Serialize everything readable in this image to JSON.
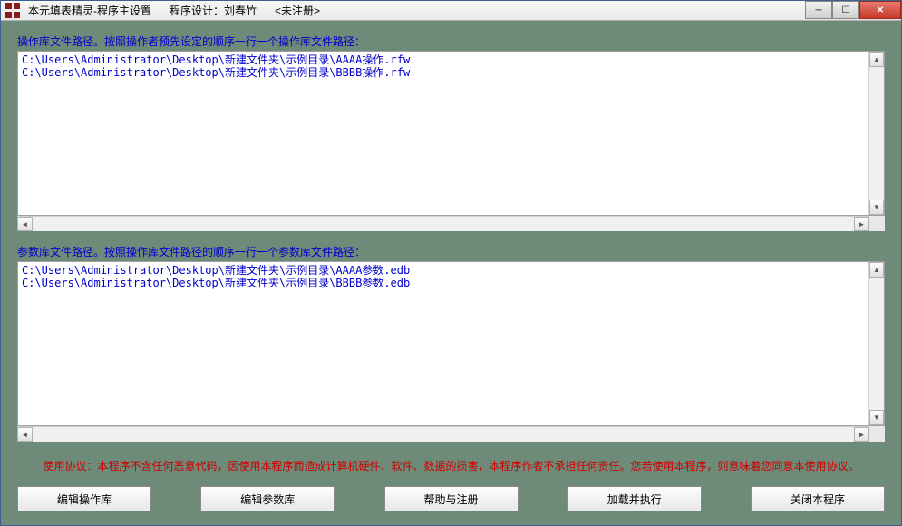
{
  "titlebar": {
    "title": "本元填表精灵-程序主设置",
    "designer": "程序设计：刘春竹",
    "registration": "<未注册>"
  },
  "section1": {
    "label": "操作库文件路径。按照操作者预先设定的顺序一行一个操作库文件路径：",
    "content": "C:\\Users\\Administrator\\Desktop\\新建文件夹\\示例目录\\AAAA操作.rfw\nC:\\Users\\Administrator\\Desktop\\新建文件夹\\示例目录\\BBBB操作.rfw"
  },
  "section2": {
    "label": "参数库文件路径。按照操作库文件路径的顺序一行一个参数库文件路径：",
    "content": "C:\\Users\\Administrator\\Desktop\\新建文件夹\\示例目录\\AAAA参数.edb\nC:\\Users\\Administrator\\Desktop\\新建文件夹\\示例目录\\BBBB参数.edb"
  },
  "agreement": "使用协议：本程序不含任何恶意代码，因使用本程序而造成计算机硬件、软件、数据的损害，本程序作者不承担任何责任。您若使用本程序，则意味着您同意本使用协议。",
  "buttons": {
    "edit_ops": "编辑操作库",
    "edit_params": "编辑参数库",
    "help_register": "帮助与注册",
    "load_execute": "加载并执行",
    "close_program": "关闭本程序"
  }
}
